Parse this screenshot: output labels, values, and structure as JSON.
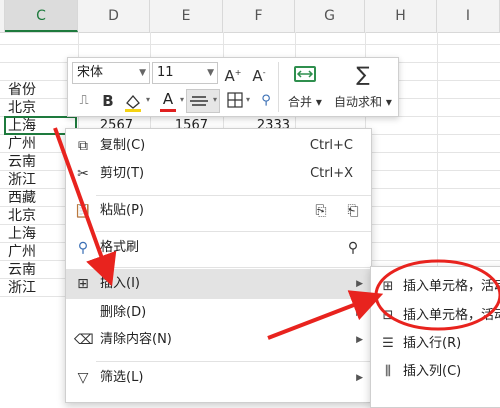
{
  "columns": [
    "C",
    "D",
    "E",
    "F",
    "G",
    "H",
    "I"
  ],
  "province_cells": [
    "省份",
    "北京",
    "上海",
    "广州",
    "云南",
    "浙江",
    "西藏",
    "北京",
    "上海",
    "广州",
    "云南",
    "浙江"
  ],
  "row_values": [
    "2567",
    "1567",
    "2333"
  ],
  "toolbar": {
    "font_name": "宋体",
    "font_size": "11",
    "merge_label": "合并",
    "autosum_label": "自动求和"
  },
  "menu": {
    "copy": {
      "label": "复制(C)",
      "shortcut": "Ctrl+C"
    },
    "cut": {
      "label": "剪切(T)",
      "shortcut": "Ctrl+X"
    },
    "paste": {
      "label": "粘贴(P)"
    },
    "format_painter": {
      "label": "格式刷"
    },
    "insert": {
      "label": "插入(I)"
    },
    "delete": {
      "label": "删除(D)"
    },
    "clear": {
      "label": "清除内容(N)"
    },
    "filter": {
      "label": "筛选(L)"
    }
  },
  "submenu": {
    "insert_cells_right": "插入单元格，活动",
    "insert_cells_down": "插入单元格，活动",
    "insert_row": "插入行(R)",
    "insert_col": "插入列(C)"
  },
  "colors": {
    "selection_green": "#1e7a3d",
    "annotation_red": "#e8231e",
    "font_color_red": "#e02020",
    "highlight_yellow": "#f5d313"
  }
}
